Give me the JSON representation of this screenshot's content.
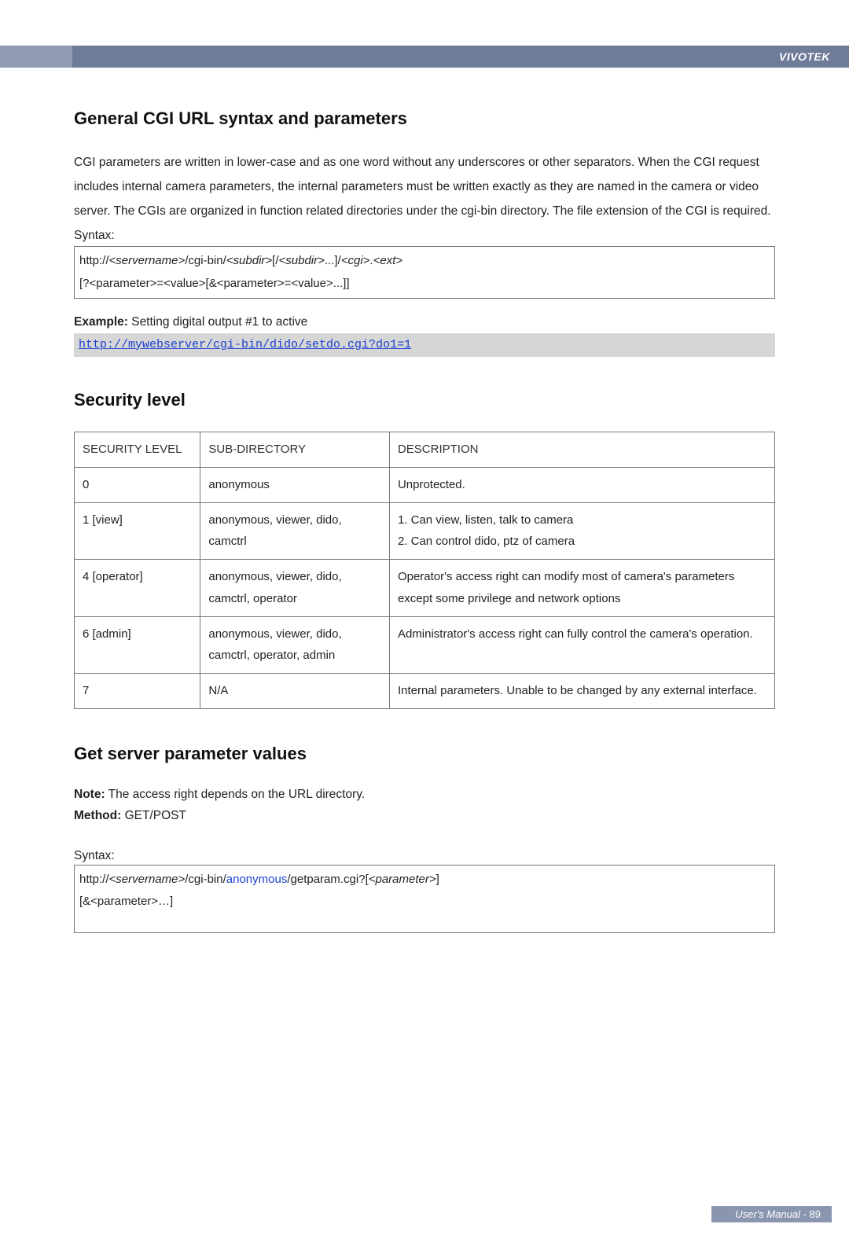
{
  "brand": "VIVOTEK",
  "section1": {
    "heading": "General CGI URL syntax and parameters",
    "paragraph": "CGI parameters are written in lower-case and as one word without any underscores or other separators. When the CGI request includes internal camera parameters, the internal parameters must be written exactly as they are named in the camera or video server. The CGIs are organized in function related directories under the cgi-bin directory. The file extension of the CGI is required.",
    "syntax_label": "Syntax:",
    "syntax_line1_a": "http://",
    "syntax_line1_b": "<servername>",
    "syntax_line1_c": "/cgi-bin/",
    "syntax_line1_d": "<subdir>",
    "syntax_line1_e": "[/",
    "syntax_line1_f": "<subdir>",
    "syntax_line1_g": "...]/",
    "syntax_line1_h": "<cgi>",
    "syntax_line1_i": ".",
    "syntax_line1_j": "<ext>",
    "syntax_line2": "[?<parameter>=<value>[&<parameter>=<value>...]]",
    "example_label": "Example:",
    "example_text": " Setting digital output #1 to active",
    "example_url": "http://mywebserver/cgi-bin/dido/setdo.cgi?do1=1"
  },
  "section2": {
    "heading": "Security level",
    "headers": {
      "c1": "SECURITY LEVEL",
      "c2": "SUB-DIRECTORY",
      "c3": "DESCRIPTION"
    },
    "rows": [
      {
        "c1": "0",
        "c2": "anonymous",
        "c3": "Unprotected."
      },
      {
        "c1": "1 [view]",
        "c2": "anonymous, viewer, dido, camctrl",
        "c3": "1. Can view, listen, talk to camera\n2. Can control dido, ptz of camera"
      },
      {
        "c1": "4 [operator]",
        "c2": "anonymous, viewer, dido, camctrl, operator",
        "c3": "Operator's access right can modify most of camera's parameters except some privilege and network options"
      },
      {
        "c1": "6 [admin]",
        "c2": "anonymous, viewer, dido, camctrl, operator, admin",
        "c3": "Administrator's access right can fully control the camera's operation."
      },
      {
        "c1": "7",
        "c2": "N/A",
        "c3": "Internal parameters. Unable to be changed by any external interface."
      }
    ]
  },
  "section3": {
    "heading": "Get server parameter values",
    "note_label": "Note:",
    "note_text": " The access right depends on the URL directory.",
    "method_label": "Method:",
    "method_text": " GET/POST",
    "syntax_label": "Syntax:",
    "line1_a": "http://",
    "line1_b": "<servername>",
    "line1_c": "/cgi-bin/",
    "line1_d": "anonymous",
    "line1_e": "/getparam.cgi?[",
    "line1_f": "<parameter>",
    "line1_g": "]",
    "line2": "[&<parameter>…]"
  },
  "footer": {
    "label": "User's Manual - ",
    "page": "89"
  }
}
